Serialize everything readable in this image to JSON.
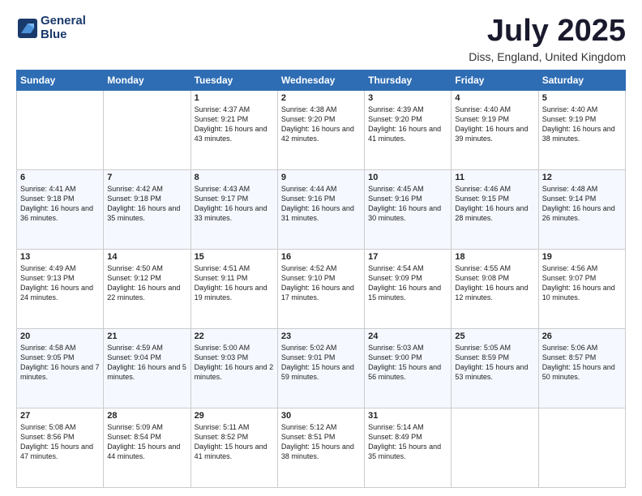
{
  "header": {
    "logo_line1": "General",
    "logo_line2": "Blue",
    "month_title": "July 2025",
    "location": "Diss, England, United Kingdom"
  },
  "weekdays": [
    "Sunday",
    "Monday",
    "Tuesday",
    "Wednesday",
    "Thursday",
    "Friday",
    "Saturday"
  ],
  "weeks": [
    [
      {
        "day": "",
        "info": ""
      },
      {
        "day": "",
        "info": ""
      },
      {
        "day": "1",
        "info": "Sunrise: 4:37 AM\nSunset: 9:21 PM\nDaylight: 16 hours and 43 minutes."
      },
      {
        "day": "2",
        "info": "Sunrise: 4:38 AM\nSunset: 9:20 PM\nDaylight: 16 hours and 42 minutes."
      },
      {
        "day": "3",
        "info": "Sunrise: 4:39 AM\nSunset: 9:20 PM\nDaylight: 16 hours and 41 minutes."
      },
      {
        "day": "4",
        "info": "Sunrise: 4:40 AM\nSunset: 9:19 PM\nDaylight: 16 hours and 39 minutes."
      },
      {
        "day": "5",
        "info": "Sunrise: 4:40 AM\nSunset: 9:19 PM\nDaylight: 16 hours and 38 minutes."
      }
    ],
    [
      {
        "day": "6",
        "info": "Sunrise: 4:41 AM\nSunset: 9:18 PM\nDaylight: 16 hours and 36 minutes."
      },
      {
        "day": "7",
        "info": "Sunrise: 4:42 AM\nSunset: 9:18 PM\nDaylight: 16 hours and 35 minutes."
      },
      {
        "day": "8",
        "info": "Sunrise: 4:43 AM\nSunset: 9:17 PM\nDaylight: 16 hours and 33 minutes."
      },
      {
        "day": "9",
        "info": "Sunrise: 4:44 AM\nSunset: 9:16 PM\nDaylight: 16 hours and 31 minutes."
      },
      {
        "day": "10",
        "info": "Sunrise: 4:45 AM\nSunset: 9:16 PM\nDaylight: 16 hours and 30 minutes."
      },
      {
        "day": "11",
        "info": "Sunrise: 4:46 AM\nSunset: 9:15 PM\nDaylight: 16 hours and 28 minutes."
      },
      {
        "day": "12",
        "info": "Sunrise: 4:48 AM\nSunset: 9:14 PM\nDaylight: 16 hours and 26 minutes."
      }
    ],
    [
      {
        "day": "13",
        "info": "Sunrise: 4:49 AM\nSunset: 9:13 PM\nDaylight: 16 hours and 24 minutes."
      },
      {
        "day": "14",
        "info": "Sunrise: 4:50 AM\nSunset: 9:12 PM\nDaylight: 16 hours and 22 minutes."
      },
      {
        "day": "15",
        "info": "Sunrise: 4:51 AM\nSunset: 9:11 PM\nDaylight: 16 hours and 19 minutes."
      },
      {
        "day": "16",
        "info": "Sunrise: 4:52 AM\nSunset: 9:10 PM\nDaylight: 16 hours and 17 minutes."
      },
      {
        "day": "17",
        "info": "Sunrise: 4:54 AM\nSunset: 9:09 PM\nDaylight: 16 hours and 15 minutes."
      },
      {
        "day": "18",
        "info": "Sunrise: 4:55 AM\nSunset: 9:08 PM\nDaylight: 16 hours and 12 minutes."
      },
      {
        "day": "19",
        "info": "Sunrise: 4:56 AM\nSunset: 9:07 PM\nDaylight: 16 hours and 10 minutes."
      }
    ],
    [
      {
        "day": "20",
        "info": "Sunrise: 4:58 AM\nSunset: 9:05 PM\nDaylight: 16 hours and 7 minutes."
      },
      {
        "day": "21",
        "info": "Sunrise: 4:59 AM\nSunset: 9:04 PM\nDaylight: 16 hours and 5 minutes."
      },
      {
        "day": "22",
        "info": "Sunrise: 5:00 AM\nSunset: 9:03 PM\nDaylight: 16 hours and 2 minutes."
      },
      {
        "day": "23",
        "info": "Sunrise: 5:02 AM\nSunset: 9:01 PM\nDaylight: 15 hours and 59 minutes."
      },
      {
        "day": "24",
        "info": "Sunrise: 5:03 AM\nSunset: 9:00 PM\nDaylight: 15 hours and 56 minutes."
      },
      {
        "day": "25",
        "info": "Sunrise: 5:05 AM\nSunset: 8:59 PM\nDaylight: 15 hours and 53 minutes."
      },
      {
        "day": "26",
        "info": "Sunrise: 5:06 AM\nSunset: 8:57 PM\nDaylight: 15 hours and 50 minutes."
      }
    ],
    [
      {
        "day": "27",
        "info": "Sunrise: 5:08 AM\nSunset: 8:56 PM\nDaylight: 15 hours and 47 minutes."
      },
      {
        "day": "28",
        "info": "Sunrise: 5:09 AM\nSunset: 8:54 PM\nDaylight: 15 hours and 44 minutes."
      },
      {
        "day": "29",
        "info": "Sunrise: 5:11 AM\nSunset: 8:52 PM\nDaylight: 15 hours and 41 minutes."
      },
      {
        "day": "30",
        "info": "Sunrise: 5:12 AM\nSunset: 8:51 PM\nDaylight: 15 hours and 38 minutes."
      },
      {
        "day": "31",
        "info": "Sunrise: 5:14 AM\nSunset: 8:49 PM\nDaylight: 15 hours and 35 minutes."
      },
      {
        "day": "",
        "info": ""
      },
      {
        "day": "",
        "info": ""
      }
    ]
  ]
}
